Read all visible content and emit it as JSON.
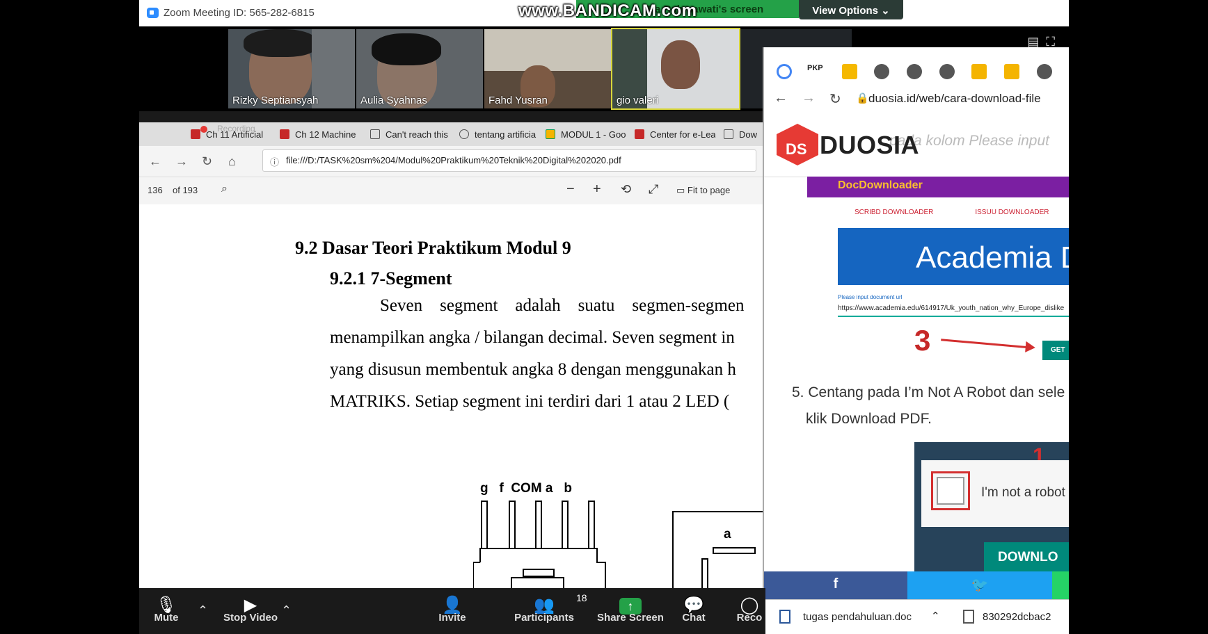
{
  "titlebar": {
    "title": "Zoom Meeting ID: 565-282-6815",
    "watermark": "www.BANDICAM.com",
    "share_banner": "Tia Rahmawati's screen",
    "view_options": "View Options"
  },
  "participants": [
    {
      "name": "Rizky Septiansyah"
    },
    {
      "name": "Aulia Syahnas"
    },
    {
      "name": "Fahd Yusran"
    },
    {
      "name": "gio valeri"
    }
  ],
  "browser": {
    "recording_label": "Recording",
    "tabs": [
      {
        "label": "Ch 11 Artificial"
      },
      {
        "label": "Ch 12 Machine"
      },
      {
        "label": "Can't reach this"
      },
      {
        "label": "tentang artificia"
      },
      {
        "label": "MODUL 1 - Goo"
      },
      {
        "label": "Center for e-Lea"
      },
      {
        "label": "Dow"
      }
    ],
    "url": "file:///D:/TASK%20sm%204/Modul%20Praktikum%20Teknik%20Digital%202020.pdf",
    "pdf": {
      "page": "136",
      "of_pages": "of 193",
      "fit_to_page": "Fit to page"
    },
    "doc": {
      "heading1": "9.2  Dasar Teori Praktikum Modul  9",
      "heading2": "9.2.1  7-Segment",
      "lines": [
        "Seven    segment    adalah    suatu    segmen-segmen",
        "menampilkan angka / bilangan decimal. Seven segment in",
        "yang disusun membentuk angka 8 dengan menggunakan h",
        "MATRIKS. Setiap segment ini terdiri dari 1 atau 2 LED ("
      ],
      "diagram_labels": "g   f  COM a   b",
      "diagram_a": "a"
    }
  },
  "duosia": {
    "url": "duosia.id/web/cara-download-file",
    "logo_mark": "DS",
    "logo_text": "DUOSIA",
    "ghost_text": "pada kolom Please input",
    "docdownloader": "DocDownloader",
    "subtab1": "SCRIBD DOWNLOADER",
    "subtab2": "ISSUU DOWNLOADER",
    "academia": "Academia D",
    "input_label": "Please input document url",
    "input_value": "https://www.academia.edu/614917/Uk_youth_nation_why_Europe_dislike",
    "step3_number": "3",
    "get_button": "GET",
    "step5_line1": "5. Centang pada I’m Not A Robot dan sele",
    "step5_line2": "klik Download PDF.",
    "robot_number": "1",
    "robot_label": "I'm not a robot",
    "download_button": "DOWNLO",
    "fb": "f",
    "tw": "🐦",
    "download_file1": "tugas pendahuluan.doc",
    "download_file2": "830292dcbac2"
  },
  "controls": {
    "mute": "Mute",
    "stop_video": "Stop Video",
    "invite": "Invite",
    "participants": "Participants",
    "participants_count": "18",
    "share_screen": "Share Screen",
    "chat": "Chat",
    "record": "Reco"
  },
  "colors": {
    "zoom_green": "#24a148",
    "duosia_red": "#e63a34",
    "academia_blue": "#1565c0"
  }
}
